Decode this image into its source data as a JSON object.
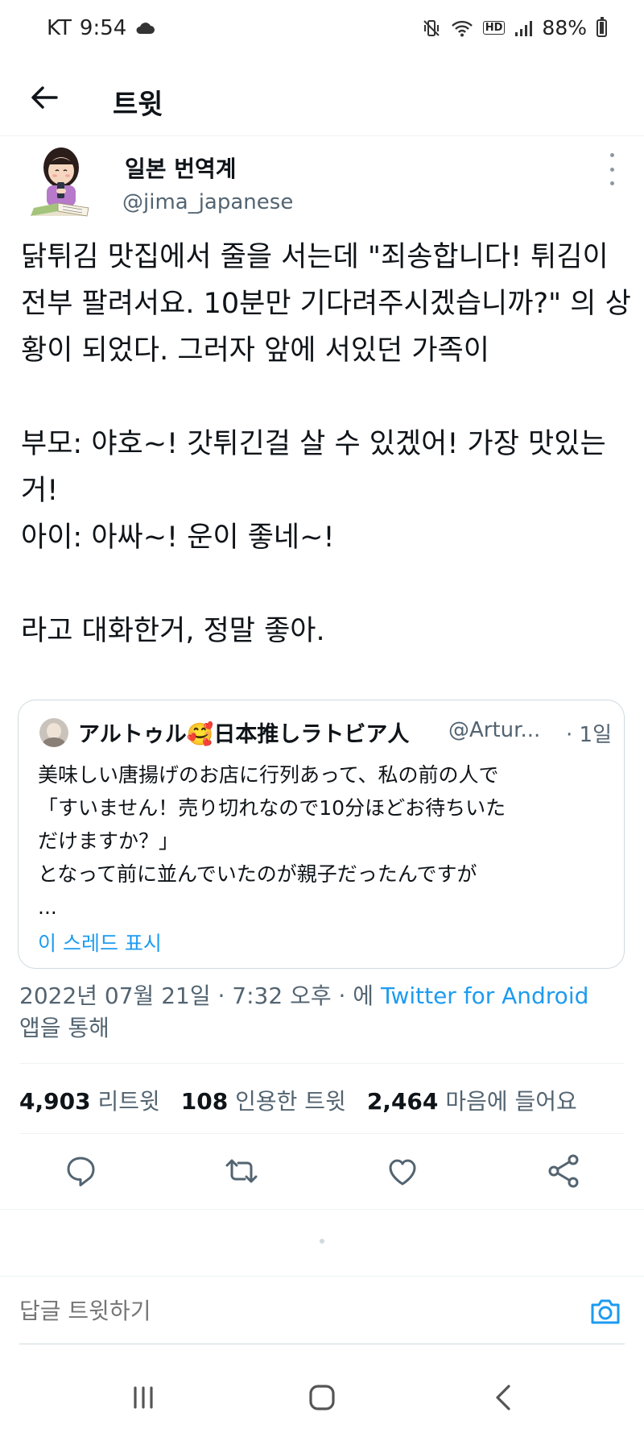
{
  "status_bar": {
    "carrier": "KT",
    "time": "9:54",
    "cloud_icon": "cloud-icon",
    "hd_label": "HD",
    "battery": "88%"
  },
  "app_bar": {
    "title": "트윗",
    "back_icon": "arrow-left-icon"
  },
  "tweet": {
    "author_name": "일본 번역계",
    "author_handle": "@jima_japanese",
    "text": "닭튀김 맛집에서 줄을 서는데 \"죄송합니다! 튀김이 전부 팔려서요. 10분만 기다려주시겠습니까?\" 의 상황이 되었다. 그러자 앞에 서있던 가족이\n\n부모: 야호~! 갓튀긴걸 살 수 있겠어! 가장 맛있는거!\n아이: 아싸~! 운이 좋네~!\n\n라고 대화한거, 정말 좋아.",
    "quote": {
      "name": "アルトゥル🥰日本推しラトビア人",
      "handle": "@Artur...",
      "time": "· 1일",
      "body_line1": "美味しい唐揚げのお店に行列あって、私の前の人で",
      "body_line2": "「すいません！売り切れなので10分ほどお待ちいた",
      "body_line3": "だけますか？」",
      "body_line4": "となって前に並んでいたのが親子だったんですが",
      "body_line5": "...",
      "show_thread": "이 스레드 표시"
    },
    "meta": {
      "datetime": "2022년 07월 21일 · 7:32 오후 · 에",
      "source": "Twitter for Android",
      "suffix": "앱을 통해"
    },
    "stats": {
      "retweets_count": "4,903",
      "retweets_label": "리트윗",
      "quotes_count": "108",
      "quotes_label": "인용한 트윗",
      "likes_count": "2,464",
      "likes_label": "마음에 들어요"
    }
  },
  "actions": [
    "reply-icon",
    "retweet-icon",
    "like-icon",
    "share-icon"
  ],
  "reply_bar": {
    "placeholder": "답글 트윗하기",
    "camera_icon": "camera-icon"
  },
  "colors": {
    "accent": "#1d9bf0",
    "text_primary": "#0f1419",
    "text_secondary": "#536471",
    "border": "#cfd9de"
  }
}
